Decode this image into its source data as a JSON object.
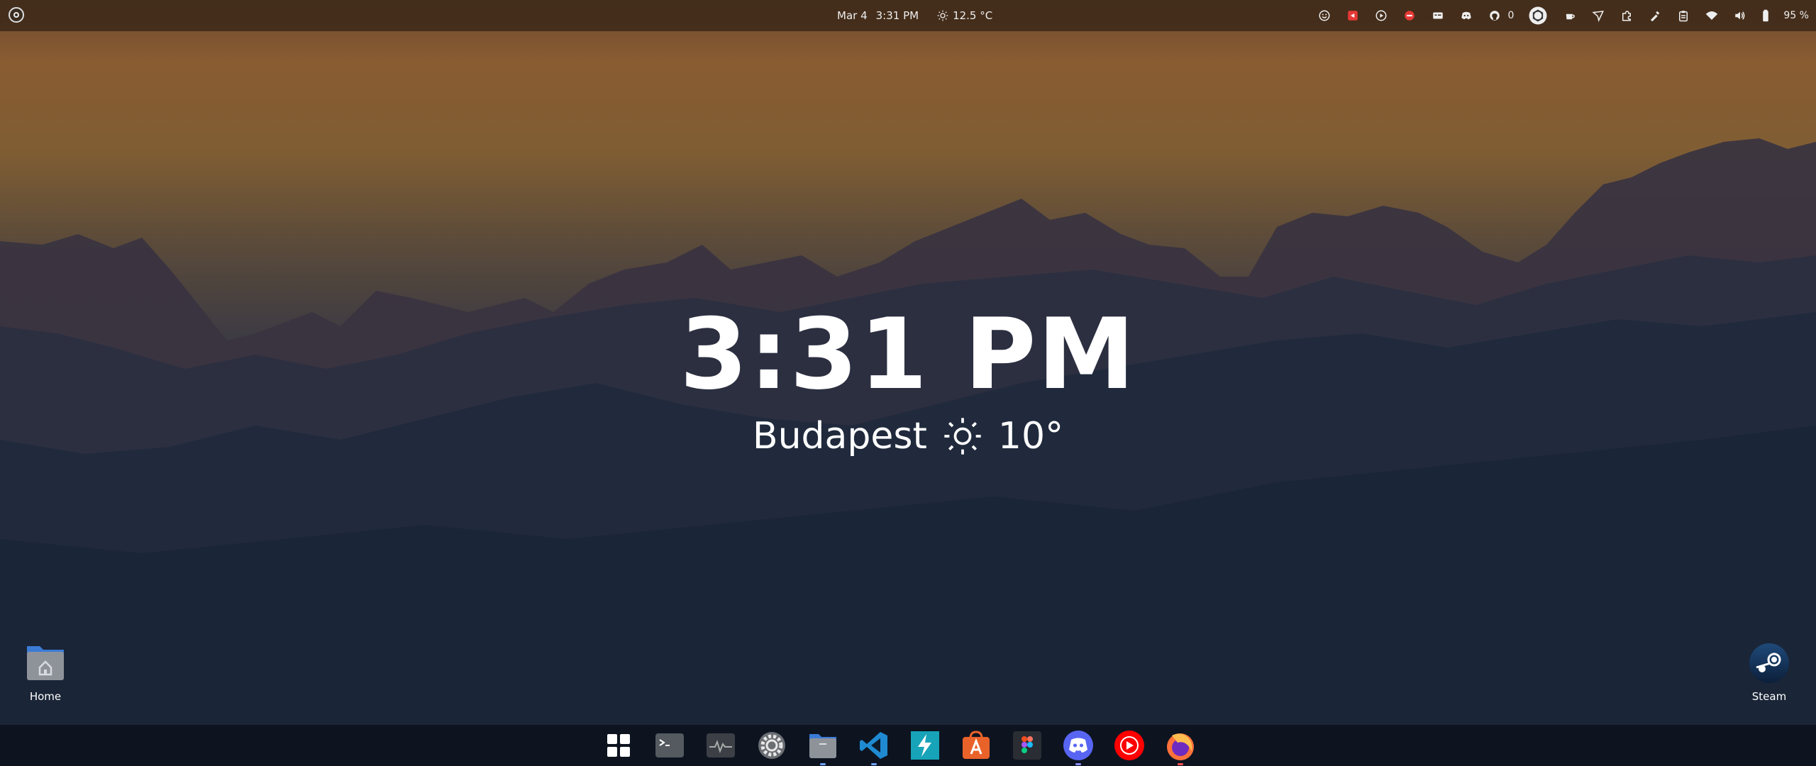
{
  "topbar": {
    "date": "Mar 4",
    "time": "3:31 PM",
    "temperature": "12.5 °C",
    "github_count": "0",
    "battery": "95 %",
    "tray_icons": [
      "emoji-icon",
      "screen-recorder-icon",
      "timer-icon",
      "stop-icon",
      "caption-icon",
      "discord-tray-icon",
      "github-icon",
      "chatgpt-icon",
      "coffee-icon",
      "send-icon",
      "extension-icon",
      "color-picker-icon",
      "clipboard-icon",
      "wifi-icon",
      "volume-icon",
      "battery-icon"
    ]
  },
  "widget": {
    "time": "3:31 PM",
    "city": "Budapest",
    "temperature": "10°"
  },
  "desktop_icons": {
    "home_label": "Home",
    "steam_label": "Steam"
  },
  "dock": {
    "items": [
      "app-grid",
      "terminal",
      "system-monitor",
      "settings",
      "files",
      "vscode",
      "lightning-app",
      "app-center",
      "figma",
      "discord",
      "youtube-music",
      "firefox"
    ]
  }
}
